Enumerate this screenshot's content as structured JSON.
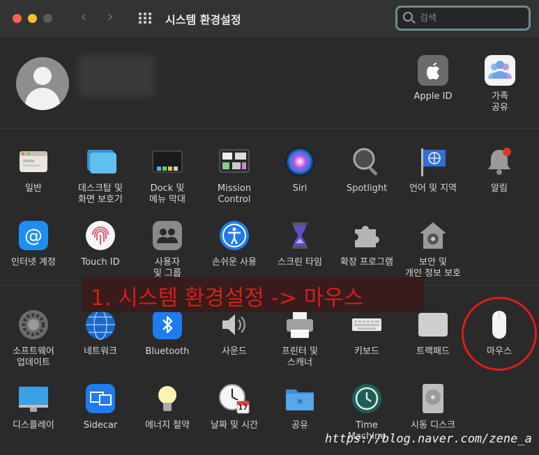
{
  "window": {
    "title": "시스템 환경설정",
    "search_placeholder": "검색"
  },
  "account": {
    "items": [
      {
        "label": "Apple ID",
        "icon": "apple-icon"
      },
      {
        "label": "가족\n공유",
        "icon": "family-sharing-icon"
      }
    ]
  },
  "panes_row1": [
    {
      "label": "일반",
      "icon": "general-icon"
    },
    {
      "label": "데스크탑 및\n화면 보호기",
      "icon": "desktop-icon"
    },
    {
      "label": "Dock 및\n메뉴 막대",
      "icon": "dock-icon"
    },
    {
      "label": "Mission\nControl",
      "icon": "mission-control-icon"
    },
    {
      "label": "Siri",
      "icon": "siri-icon"
    },
    {
      "label": "Spotlight",
      "icon": "spotlight-icon"
    },
    {
      "label": "언어 및 지역",
      "icon": "language-icon"
    },
    {
      "label": "알림",
      "icon": "notification-bell-icon"
    }
  ],
  "panes_row2": [
    {
      "label": "인터넷 계정",
      "icon": "at-sign-icon"
    },
    {
      "label": "Touch ID",
      "icon": "fingerprint-icon"
    },
    {
      "label": "사용자\n및 그룹",
      "icon": "users-icon"
    },
    {
      "label": "손쉬운 사용",
      "icon": "accessibility-icon"
    },
    {
      "label": "스크린 타임",
      "icon": "hourglass-icon"
    },
    {
      "label": "확장 프로그램",
      "icon": "puzzle-icon"
    },
    {
      "label": "보안 및\n개인 정보 보호",
      "icon": "security-house-icon"
    }
  ],
  "panes_row3": [
    {
      "label": "소프트웨어\n업데이트",
      "icon": "gear-icon"
    },
    {
      "label": "네트워크",
      "icon": "globe-icon"
    },
    {
      "label": "Bluetooth",
      "icon": "bluetooth-icon"
    },
    {
      "label": "사운드",
      "icon": "speaker-icon"
    },
    {
      "label": "프린터 및\n스캐너",
      "icon": "printer-icon"
    },
    {
      "label": "키보드",
      "icon": "keyboard-icon"
    },
    {
      "label": "트랙패드",
      "icon": "trackpad-icon"
    },
    {
      "label": "마우스",
      "icon": "mouse-icon"
    }
  ],
  "panes_row4": [
    {
      "label": "디스플레이",
      "icon": "display-icon"
    },
    {
      "label": "Sidecar",
      "icon": "sidecar-icon"
    },
    {
      "label": "에너지 절약",
      "icon": "lightbulb-icon"
    },
    {
      "label": "날짜 및 시간",
      "icon": "clock-calendar-icon"
    },
    {
      "label": "공유",
      "icon": "shared-folder-icon"
    },
    {
      "label": "Time\nMachine",
      "icon": "time-machine-icon"
    },
    {
      "label": "시동 디스크",
      "icon": "disk-icon"
    }
  ],
  "calendar_day": "17",
  "annotation": "1. 시스템 환경설정 -> 마우스",
  "watermark": "https://blog.naver.com/zene_a",
  "colors": {
    "traffic_red": "#fe5f57",
    "traffic_yellow": "#febc2e",
    "annotation_red": "#e21d1d"
  }
}
